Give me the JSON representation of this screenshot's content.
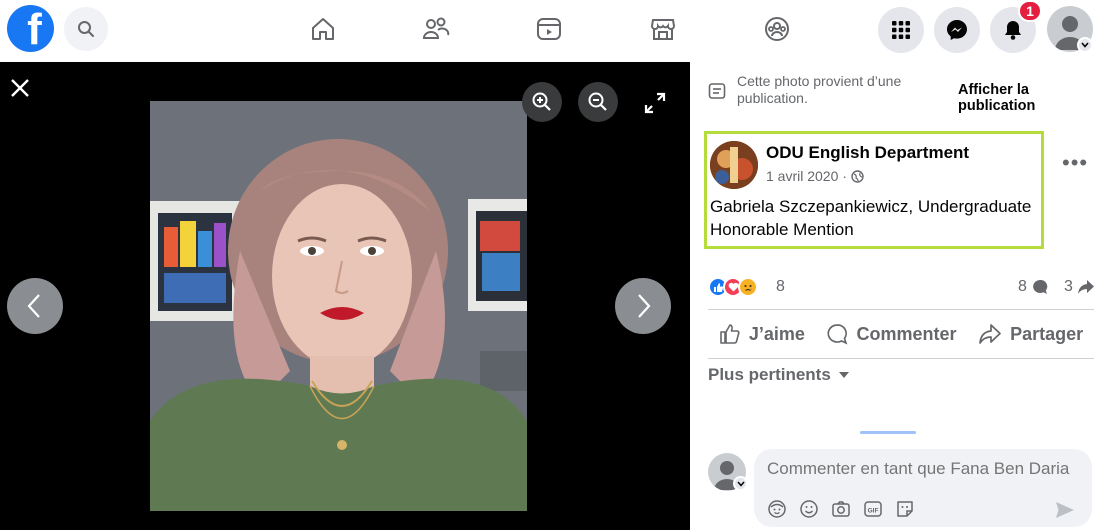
{
  "topbar": {
    "logo_letter": "f",
    "notifications_count": "1",
    "nav_icons": [
      "home-icon",
      "friends-icon",
      "watch-icon",
      "marketplace-icon",
      "groups-icon"
    ],
    "right_icons": [
      "menu-grid-icon",
      "messenger-icon",
      "bell-icon"
    ]
  },
  "viewer": {
    "controls": [
      "close-icon",
      "zoom-in-icon",
      "zoom-out-icon",
      "fullscreen-icon",
      "previous-arrow-icon",
      "next-arrow-icon"
    ]
  },
  "panel": {
    "source_text": "Cette photo provient d’une publication.",
    "source_link": "Afficher la publication",
    "post": {
      "author": "ODU English Department",
      "date": "1 avril 2020 ·",
      "text": "Gabriela Szczepankiewicz, Undergraduate Honorable Mention"
    },
    "more_label": "•••",
    "reactions": {
      "icons": [
        "like-icon",
        "love-icon",
        "sad-icon"
      ],
      "count": "8",
      "comments": "8",
      "shares": "3"
    },
    "actions": {
      "like": "J’aime",
      "comment": "Commenter",
      "share": "Partager"
    },
    "sort_label": "Plus pertinents",
    "comment_box": {
      "placeholder": "Commenter en tant que Fana Ben Daria",
      "tools": [
        "avatar-sticker-icon",
        "emoji-icon",
        "camera-icon",
        "gif-icon",
        "sticker-icon"
      ]
    }
  },
  "colors": {
    "brand": "#1877f2",
    "badge": "#e41e3f",
    "highlight_border": "#b4dc3a",
    "secondary_text": "#65676b"
  }
}
